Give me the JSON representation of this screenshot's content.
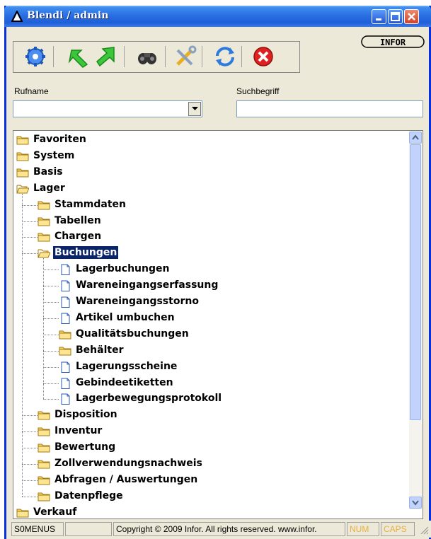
{
  "window": {
    "title": "Blendi / admin",
    "brand": "INFOR"
  },
  "toolbar": {
    "tools": [
      "gear-icon",
      "green-arrow-down-icon",
      "green-arrow-right-icon",
      "binoculars-icon",
      "tools-icon",
      "refresh-icon",
      "close-red-icon"
    ]
  },
  "fields": {
    "rufname_label": "Rufname",
    "suchbegriff_label": "Suchbegriff",
    "rufname_value": "",
    "suchbegriff_value": ""
  },
  "tree": {
    "items": [
      {
        "label": "Favoriten",
        "type": "folder",
        "level": 0
      },
      {
        "label": "System",
        "type": "folder",
        "level": 0
      },
      {
        "label": "Basis",
        "type": "folder",
        "level": 0
      },
      {
        "label": "Lager",
        "type": "folder-open",
        "level": 0
      },
      {
        "label": "Stammdaten",
        "type": "folder",
        "level": 1
      },
      {
        "label": "Tabellen",
        "type": "folder",
        "level": 1
      },
      {
        "label": "Chargen",
        "type": "folder",
        "level": 1
      },
      {
        "label": "Buchungen",
        "type": "folder-open",
        "level": 1,
        "selected": true
      },
      {
        "label": "Lagerbuchungen",
        "type": "doc",
        "level": 2
      },
      {
        "label": "Wareneingangserfassung",
        "type": "doc",
        "level": 2
      },
      {
        "label": "Wareneingangsstorno",
        "type": "doc",
        "level": 2
      },
      {
        "label": "Artikel umbuchen",
        "type": "doc",
        "level": 2
      },
      {
        "label": "Qualitätsbuchungen",
        "type": "folder",
        "level": 2
      },
      {
        "label": "Behälter",
        "type": "folder",
        "level": 2
      },
      {
        "label": "Lagerungsscheine",
        "type": "doc",
        "level": 2
      },
      {
        "label": "Gebindeetiketten",
        "type": "doc",
        "level": 2
      },
      {
        "label": "Lagerbewegungsprotokoll",
        "type": "doc",
        "level": 2
      },
      {
        "label": "Disposition",
        "type": "folder",
        "level": 1
      },
      {
        "label": "Inventur",
        "type": "folder",
        "level": 1
      },
      {
        "label": "Bewertung",
        "type": "folder",
        "level": 1
      },
      {
        "label": "Zollverwendungsnachweis",
        "type": "folder",
        "level": 1
      },
      {
        "label": "Abfragen / Auswertungen",
        "type": "folder",
        "level": 1
      },
      {
        "label": "Datenpflege",
        "type": "folder",
        "level": 1
      },
      {
        "label": "Verkauf",
        "type": "folder",
        "level": 0
      }
    ]
  },
  "statusbar": {
    "module": "S0MENUS",
    "blank": "",
    "copyright": "Copyright © 2009 Infor. All rights reserved. www.infor.",
    "num": "NUM",
    "caps": "CAPS"
  }
}
